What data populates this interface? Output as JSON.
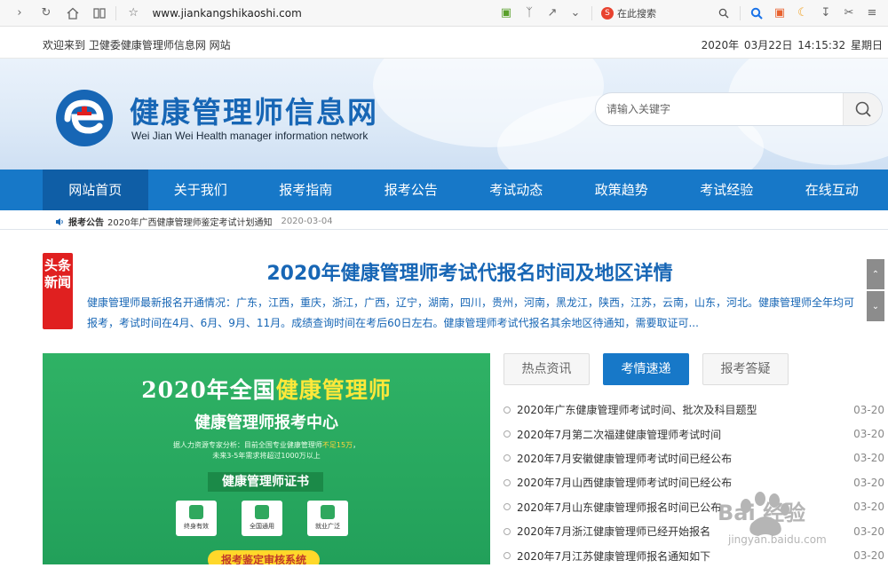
{
  "browser": {
    "url": "www.jiankangshikaoshi.com",
    "search_placeholder": "在此搜索",
    "sogou_label": "S"
  },
  "topbar": {
    "welcome": "欢迎来到 卫健委健康管理师信息网 网站",
    "datetime": "2020年 03月22日  14:15:32  星期日"
  },
  "site": {
    "title": "健康管理师信息网",
    "subtitle": "Wei Jian Wei Health manager information network",
    "search_placeholder": "请输入关键字"
  },
  "nav": {
    "items": [
      "网站首页",
      "关于我们",
      "报考指南",
      "报考公告",
      "考试动态",
      "政策趋势",
      "考试经验",
      "在线互动"
    ],
    "active_index": 0
  },
  "notice": {
    "tag": "报考公告",
    "text": "2020年广西健康管理师鉴定考试计划通知",
    "date": "2020-03-04"
  },
  "headline": {
    "badge": "头条新闻",
    "title": "2020年健康管理师考试代报名时间及地区详情",
    "body": "健康管理师最新报名开通情况：广东，江西，重庆，浙江，广西，辽宁，湖南，四川，贵州，河南，黑龙江，陕西，江苏，云南，山东，河北。健康管理师全年均可报考，考试时间在4月、6月、9月、11月。成绩查询时间在考后60日左右。健康管理师考试代报名其余地区待通知，需要取证可..."
  },
  "banner": {
    "line1_prefix": "2020年全国",
    "line1_highlight": "健康管理师",
    "line2": "健康管理师报考中心",
    "note_prefix": "据人力资源专家分析：目前全国专业健康管理师",
    "note_red": "不足15万",
    "note_line2": "未来3-5年需求将超过1000万以上",
    "ribbon": "健康管理师证书",
    "cards": [
      "终身有效",
      "全国通用",
      "就业广泛"
    ],
    "cta": "报考鉴定审核系统"
  },
  "tabs": {
    "items": [
      "热点资讯",
      "考情速递",
      "报考答疑"
    ],
    "active_index": 1
  },
  "articles": [
    {
      "title": "2020年广东健康管理师考试时间、批次及科目题型",
      "date": "03-20"
    },
    {
      "title": "2020年7月第二次福建健康管理师考试时间",
      "date": "03-20"
    },
    {
      "title": "2020年7月安徽健康管理师考试时间已经公布",
      "date": "03-20"
    },
    {
      "title": "2020年7月山西健康管理师考试时间已经公布",
      "date": "03-20"
    },
    {
      "title": "2020年7月山东健康管理师报名时间已公布",
      "date": "03-20"
    },
    {
      "title": "2020年7月浙江健康管理师已经开始报名",
      "date": "03-20"
    },
    {
      "title": "2020年7月江苏健康管理师报名通知如下",
      "date": "03-20"
    }
  ],
  "watermark": {
    "brand": "Bai 经验",
    "url": "jingyan.baidu.com"
  },
  "colors": {
    "brand_blue": "#1778c8",
    "nav_active": "#0f5ea6",
    "headline_red": "#e02020",
    "banner_green": "#2fb265"
  }
}
